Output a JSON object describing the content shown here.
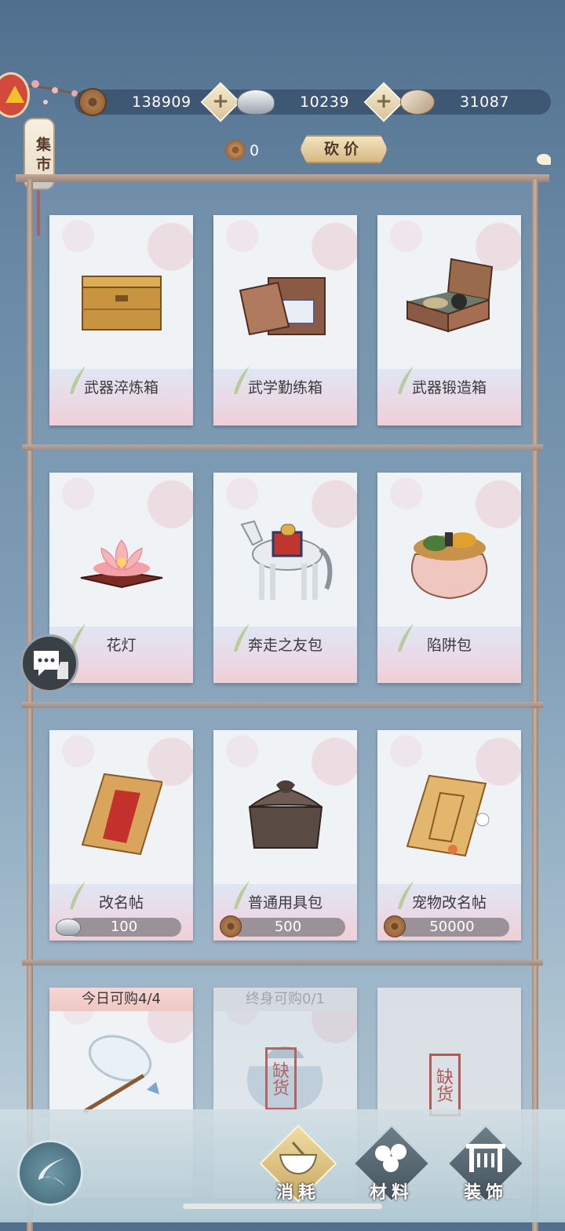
{
  "currency": {
    "copper": "138909",
    "silver": "10239",
    "shell": "31087",
    "token_count": "0"
  },
  "bargain_label": "砍价",
  "market_label": "集市",
  "items": [
    {
      "name": "武器淬炼箱",
      "icon": "wooden-chest-icon"
    },
    {
      "name": "武学勤练箱",
      "icon": "scroll-box-icon"
    },
    {
      "name": "武器锻造箱",
      "icon": "open-box-icon"
    },
    {
      "name": "花灯",
      "icon": "lotus-lamp-icon"
    },
    {
      "name": "奔走之友包",
      "icon": "horse-icon"
    },
    {
      "name": "陷阱包",
      "icon": "sack-icon"
    },
    {
      "name": "改名帖",
      "icon": "rename-card-icon",
      "price": "100",
      "currency": "silver"
    },
    {
      "name": "普通用具包",
      "icon": "cloth-bundle-icon",
      "price": "500",
      "currency": "copper"
    },
    {
      "name": "宠物改名帖",
      "icon": "pet-rename-card-icon",
      "price": "50000",
      "currency": "copper"
    }
  ],
  "row4": [
    {
      "limit": "今日可购4/4",
      "icon": "butterfly-net-icon"
    },
    {
      "limit": "终身可购0/1",
      "stock": "缺货",
      "icon": "bundle-icon"
    },
    {
      "stock": "缺货"
    }
  ],
  "tabs": [
    {
      "label": "消耗"
    },
    {
      "label": "材料"
    },
    {
      "label": "装饰"
    }
  ]
}
